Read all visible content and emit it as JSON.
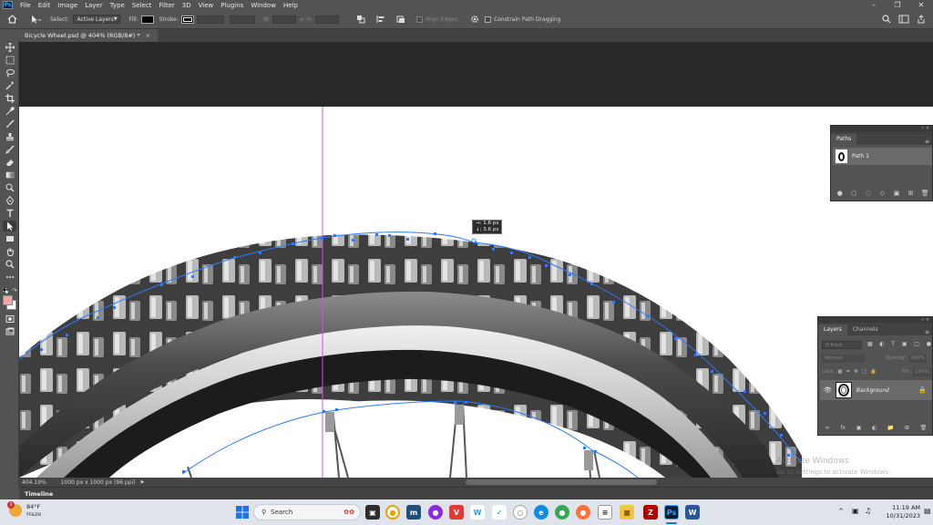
{
  "menu": {
    "app_icon": "Ps",
    "items": [
      "File",
      "Edit",
      "Image",
      "Layer",
      "Type",
      "Select",
      "Filter",
      "3D",
      "View",
      "Plugins",
      "Window",
      "Help"
    ]
  },
  "options": {
    "select_label": "Select:",
    "select_value": "Active Layers",
    "fill_label": "Fill:",
    "stroke_label": "Stroke:",
    "w_label": "W:",
    "h_label": "H:",
    "align_edges_label": "Align Edges",
    "constrain_label": "Constrain Path Dragging"
  },
  "document": {
    "tab_title": "Bicycle Wheel.psd @ 404% (RGB/8#) *",
    "zoom": "404.19%",
    "doc_size": "1000 px x 1000 px (96 ppi)"
  },
  "tooltip": {
    "line1": "→: 1.6 px",
    "line2": "↓: 3.6 px"
  },
  "paths_panel": {
    "tab": "Paths",
    "path_name": "Path 1"
  },
  "layers_panel": {
    "tabs": [
      "Layers",
      "Channels"
    ],
    "kind_placeholder": "Kind",
    "blend_mode": "Normal",
    "opacity_label": "Opacity:",
    "opacity_value": "100%",
    "lock_label": "Lock:",
    "fill_label": "Fill:",
    "fill_value": "100%",
    "layer_name": "Background"
  },
  "timeline": {
    "label": "Timeline"
  },
  "watermark": {
    "line1": "Activate Windows",
    "line2": "Go to Settings to activate Windows."
  },
  "taskbar": {
    "weather_temp": "84°F",
    "weather_desc": "Haze",
    "weather_badge": "1",
    "search_placeholder": "Search",
    "time": "11:19 AM",
    "date": "10/31/2023"
  },
  "colors": {
    "ui_bg": "#535353",
    "path_blue": "#2a7bff",
    "guide_magenta": "#e14be0",
    "taskbar_bg": "#dfe3ea"
  }
}
